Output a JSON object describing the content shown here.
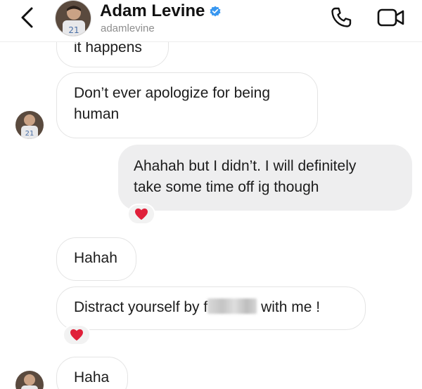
{
  "header": {
    "display_name": "Adam Levine",
    "username": "adamlevine",
    "back_icon": "chevron-left-icon",
    "verified_icon": "verified-badge-icon",
    "call_icon": "phone-icon",
    "video_icon": "video-camera-icon"
  },
  "messages": [
    {
      "direction": "incoming",
      "text": "it happens"
    },
    {
      "direction": "incoming",
      "line1": "Don’t ever apologize for being",
      "line2": "human"
    },
    {
      "direction": "outgoing",
      "line1": "Ahahah but I didn’t. I will definitely",
      "line2": "take some time off ig though",
      "reaction": "❤️"
    },
    {
      "direction": "incoming",
      "text": "Hahah"
    },
    {
      "direction": "incoming",
      "before": "Distract yourself by f",
      "after": "with me !",
      "reaction": "❤️"
    },
    {
      "direction": "incoming",
      "text": "Haha"
    }
  ],
  "colors": {
    "verified": "#3897f0",
    "heart": "#e0203a",
    "outgoing_bubble": "#eeeeef",
    "incoming_border": "#e4e4e4"
  }
}
